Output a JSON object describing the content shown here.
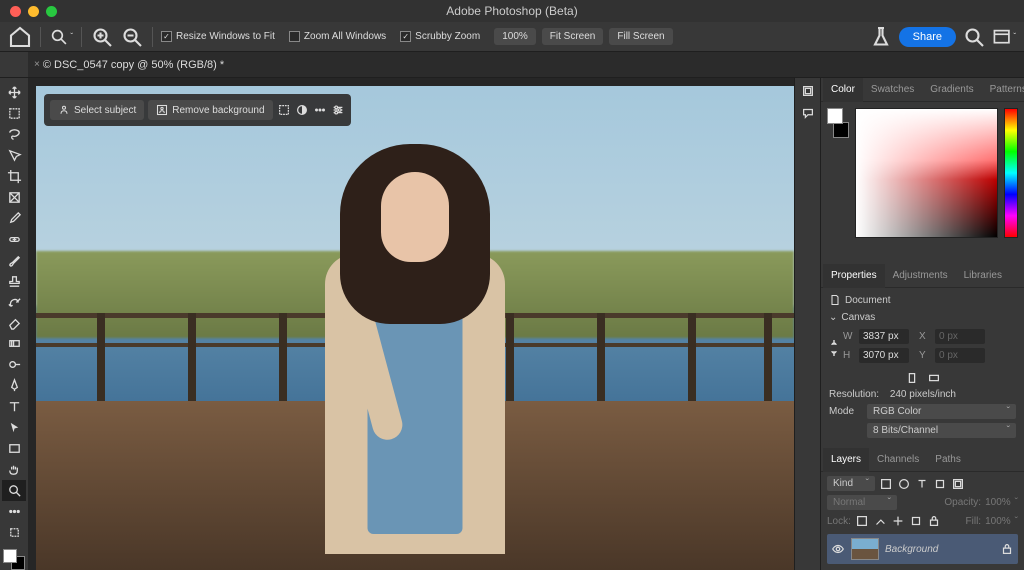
{
  "app_title": "Adobe Photoshop (Beta)",
  "options_bar": {
    "resize_fit": "Resize Windows to Fit",
    "zoom_all": "Zoom All Windows",
    "scrubby": "Scrubby Zoom",
    "zoom_pct": "100%",
    "fit_screen": "Fit Screen",
    "fill_screen": "Fill Screen"
  },
  "share_label": "Share",
  "document_tab": "© DSC_0547 copy @ 50% (RGB/8) *",
  "context_bar": {
    "select_subject": "Select subject",
    "remove_bg": "Remove background"
  },
  "color_panel_tabs": [
    "Color",
    "Swatches",
    "Gradients",
    "Patterns"
  ],
  "props_tabs": [
    "Properties",
    "Adjustments",
    "Libraries"
  ],
  "props": {
    "doc_label": "Document",
    "canvas_header": "Canvas",
    "w_label": "W",
    "w_val": "3837 px",
    "x_label": "X",
    "x_val": "0 px",
    "h_label": "H",
    "h_val": "3070 px",
    "y_label": "Y",
    "y_val": "0 px",
    "res_label": "Resolution:",
    "res_val": "240 pixels/inch",
    "mode_label": "Mode",
    "mode_val": "RGB Color",
    "depth_val": "8 Bits/Channel"
  },
  "layers_tabs": [
    "Layers",
    "Channels",
    "Paths"
  ],
  "layers": {
    "kind": "Kind",
    "blend": "Normal",
    "opacity_label": "Opacity:",
    "opacity_val": "100%",
    "lock_label": "Lock:",
    "fill_label": "Fill:",
    "fill_val": "100%",
    "bg_name": "Background"
  }
}
